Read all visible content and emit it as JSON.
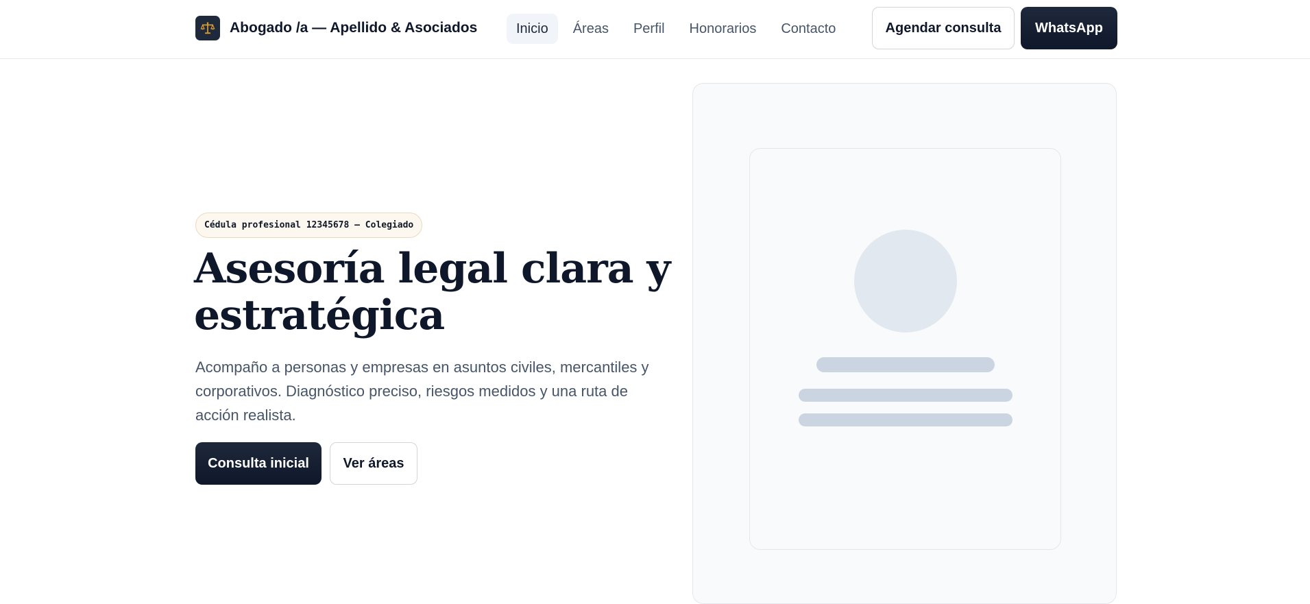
{
  "header": {
    "brand_icon": "scales-of-justice-icon",
    "brand_name": "Abogado /a — Apellido & Asociados",
    "nav": [
      {
        "label": "Inicio",
        "active": true
      },
      {
        "label": "Áreas",
        "active": false
      },
      {
        "label": "Perfil",
        "active": false
      },
      {
        "label": "Honorarios",
        "active": false
      },
      {
        "label": "Contacto",
        "active": false
      }
    ],
    "schedule_button": "Agendar consulta",
    "whatsapp_button": "WhatsApp"
  },
  "hero": {
    "badge": "Cédula profesional 12345678 — Colegiado",
    "title": "Asesoría legal clara y estratégica",
    "description": "Acompaño a personas y empresas en asuntos civiles, mercantiles y corporativos. Diagnóstico preciso, riesgos medidos y una ruta de acción realista.",
    "primary_button": "Consulta inicial",
    "secondary_button": "Ver áreas"
  },
  "colors": {
    "primary_dark": "#0f172a",
    "accent_gold": "#e0a030",
    "muted_text": "#475569",
    "placeholder": "#cbd5e1"
  }
}
